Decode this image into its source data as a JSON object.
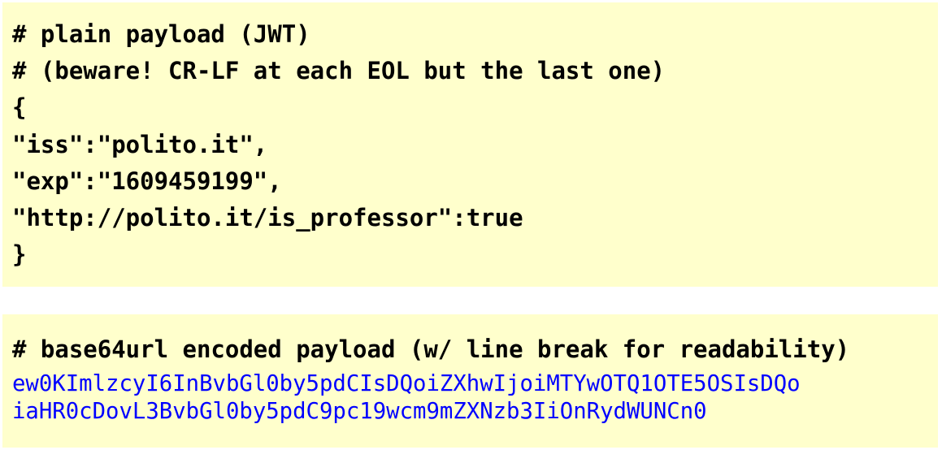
{
  "colors": {
    "background": "#ffffcc",
    "text": "#000000",
    "encoded_text": "#0000ff"
  },
  "plain_payload": {
    "lines": [
      "# plain payload (JWT)",
      "# (beware! CR-LF at each EOL but the last one)",
      "{",
      "\"iss\":\"polito.it\",",
      "\"exp\":\"1609459199\",",
      "\"http://polito.it/is_professor\":true",
      "}"
    ]
  },
  "encoded_payload": {
    "comment": "# base64url encoded payload (w/ line break for readability)",
    "lines": [
      "ew0KImlzcyI6InBvbGl0by5pdCIsDQoiZXhwIjoiMTYwOTQ1OTE5OSIsDQo",
      "iaHR0cDovL3BvbGl0by5pdC9pc19wcm9mZXNzb3IiOnRydWUNCn0"
    ]
  }
}
